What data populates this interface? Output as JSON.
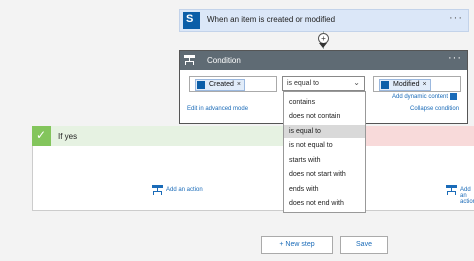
{
  "trigger": {
    "title": "When an item is created or modified",
    "icon": "sharepoint-icon",
    "more": "···"
  },
  "connector": {
    "plus": "+"
  },
  "condition": {
    "title": "Condition",
    "more": "···",
    "left_token": "Created",
    "right_token": "Modified",
    "token_remove": "×",
    "operator": "is equal to",
    "edit_advanced": "Edit in advanced mode",
    "add_dynamic": "Add dynamic content",
    "collapse": "Collapse condition"
  },
  "dropdown": {
    "chevron": "⌄",
    "options": [
      "contains",
      "does not contain",
      "is equal to",
      "is not equal to",
      "starts with",
      "does not start with",
      "ends with",
      "does not end with"
    ],
    "selected_index": 2
  },
  "branch": {
    "yes_label": "If yes",
    "check": "✓",
    "add_action": "Add an action"
  },
  "footer": {
    "new_step": "+ New step",
    "save": "Save"
  },
  "colors": {
    "accent": "#1a6bb8",
    "condition_header": "#5f6b74",
    "yes_green": "#83c55c",
    "no_red": "#f8dada"
  }
}
